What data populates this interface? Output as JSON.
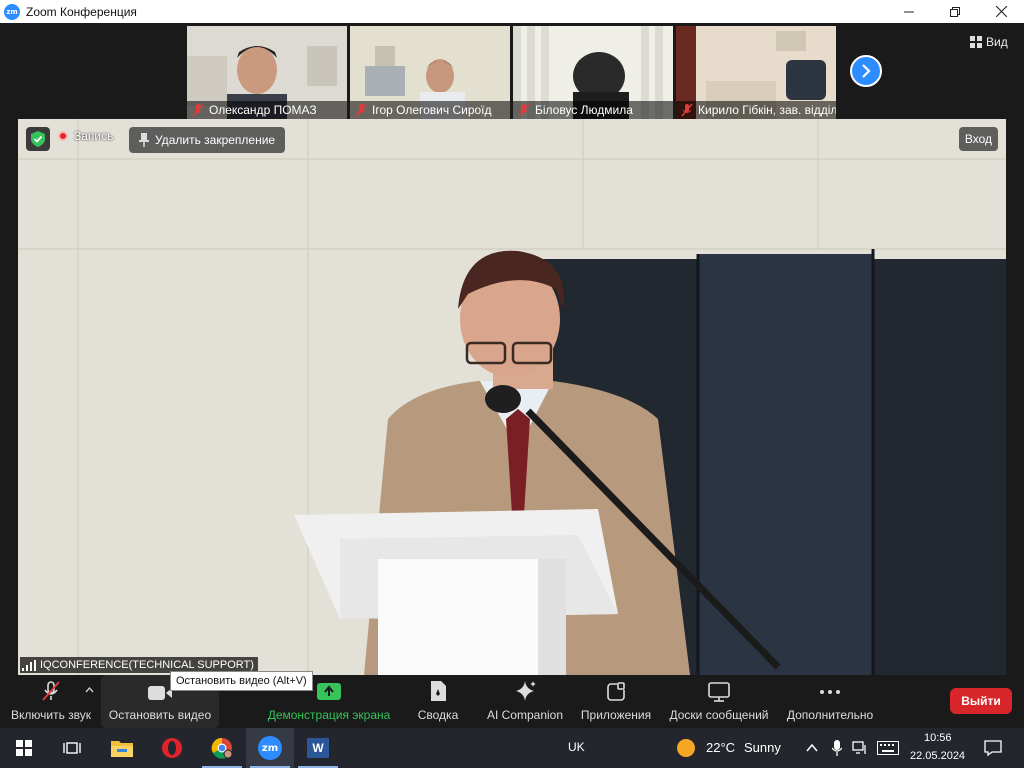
{
  "window": {
    "title": "Zoom Конференция",
    "app_icon_text": "zm"
  },
  "top_strip": {
    "participants": [
      {
        "name": "Олександр ПОМАЗ"
      },
      {
        "name": "Ігор Олегович Сироїд"
      },
      {
        "name": "Біловус Людмила"
      },
      {
        "name": "Кирило Гібкін, зав. відділом"
      }
    ],
    "view_label": "Вид"
  },
  "stage": {
    "record_label": "Запись",
    "unpin_label": "Удалить закрепление",
    "enter_label": "Вход",
    "speaker_name": "IQCONFERENCE(TECHNICAL SUPPORT)"
  },
  "toolbar": {
    "unmute_label": "Включить звук",
    "stop_video_label": "Остановить видео",
    "share_label": "Демонстрация экрана",
    "summary_label": "Сводка",
    "ai_label": "AI Companion",
    "apps_label": "Приложения",
    "boards_label": "Доски сообщений",
    "more_label": "Дополнительно",
    "leave_label": "Выйти",
    "tooltip": "Остановить видео (Alt+V)",
    "share_color": "#36c45a",
    "leave_color": "#d9262b"
  },
  "taskbar": {
    "opera_label": "O",
    "zoom_label": "zm",
    "word_label": "W",
    "language": "UK",
    "weather_temp": "22°C",
    "weather_text": "Sunny",
    "time": "10:56",
    "date": "22.05.2024"
  }
}
